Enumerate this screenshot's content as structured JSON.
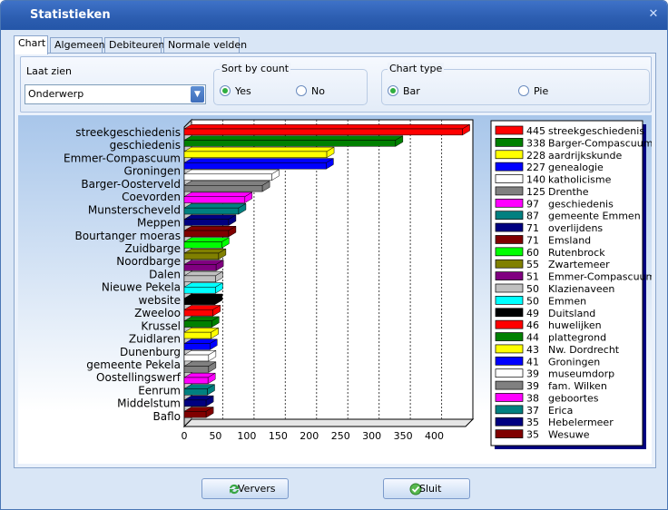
{
  "window": {
    "title": "Statistieken"
  },
  "tabs": [
    {
      "label": "Chart",
      "active": true
    },
    {
      "label": "Algemeen",
      "active": false
    },
    {
      "label": "Debiteuren",
      "active": false
    },
    {
      "label": "Normale velden",
      "active": false
    }
  ],
  "options": {
    "show_label": "Laat zien",
    "show_value": "Onderwerp",
    "sort_label": "Sort by count",
    "sort_yes": "Yes",
    "sort_no": "No",
    "sort_selected": "Yes",
    "type_label": "Chart type",
    "type_bar": "Bar",
    "type_pie": "Pie",
    "type_selected": "Bar"
  },
  "buttons": {
    "refresh": "Ververs",
    "close": "Sluit"
  },
  "chart_data": {
    "type": "bar",
    "orientation": "horizontal",
    "grid": true,
    "legend_position": "right",
    "xlim": [
      0,
      450
    ],
    "xticks": [
      0,
      50,
      100,
      150,
      200,
      250,
      300,
      350,
      400
    ],
    "axis_labels": [
      "streekgeschiedenis",
      "geschiedenis",
      "Emmer-Compascuum",
      "Groningen",
      "Barger-Oosterveld",
      "Coevorden",
      "Munsterscheveld",
      "Meppen",
      "Bourtanger moeras",
      "Zuidbarge",
      "Noordbarge",
      "Dalen",
      "Nieuwe Pekela",
      "website",
      "Zweeloo",
      "Krussel",
      "Zuidlaren",
      "Dunenburg",
      "gemeente Pekela",
      "Oostellingswerf",
      "Eenrum",
      "Middelstum",
      "Baflo"
    ],
    "series": [
      {
        "category": "streekgeschiedenis",
        "value": 445,
        "color": "#ff0000"
      },
      {
        "category": "Barger-Compascuum",
        "value": 338,
        "color": "#008000"
      },
      {
        "category": "aardrijkskunde",
        "value": 228,
        "color": "#ffff00"
      },
      {
        "category": "genealogie",
        "value": 227,
        "color": "#0000ff"
      },
      {
        "category": "katholicisme",
        "value": 140,
        "color": "#ffffff"
      },
      {
        "category": "Drenthe",
        "value": 125,
        "color": "#808080"
      },
      {
        "category": "geschiedenis",
        "value": 97,
        "color": "#ff00ff"
      },
      {
        "category": "gemeente Emmen",
        "value": 87,
        "color": "#008080"
      },
      {
        "category": "overlijdens",
        "value": 71,
        "color": "#000080"
      },
      {
        "category": "Emsland",
        "value": 71,
        "color": "#800000"
      },
      {
        "category": "Rutenbrock",
        "value": 60,
        "color": "#00ff00"
      },
      {
        "category": "Zwartemeer",
        "value": 55,
        "color": "#808000"
      },
      {
        "category": "Emmer-Compascuum",
        "value": 51,
        "color": "#800080"
      },
      {
        "category": "Klazienaveen",
        "value": 50,
        "color": "#c0c0c0"
      },
      {
        "category": "Emmen",
        "value": 50,
        "color": "#00ffff"
      },
      {
        "category": "Duitsland",
        "value": 49,
        "color": "#000000"
      },
      {
        "category": "huwelijken",
        "value": 46,
        "color": "#ff0000"
      },
      {
        "category": "plattegrond",
        "value": 44,
        "color": "#008000"
      },
      {
        "category": "Nw. Dordrecht",
        "value": 43,
        "color": "#ffff00"
      },
      {
        "category": "Groningen",
        "value": 41,
        "color": "#0000ff"
      },
      {
        "category": "museumdorp",
        "value": 39,
        "color": "#ffffff"
      },
      {
        "category": "fam. Wilken",
        "value": 39,
        "color": "#808080"
      },
      {
        "category": "geboortes",
        "value": 38,
        "color": "#ff00ff"
      },
      {
        "category": "Erica",
        "value": 37,
        "color": "#008080"
      },
      {
        "category": "Hebelermeer",
        "value": 35,
        "color": "#000080"
      },
      {
        "category": "Wesuwe",
        "value": 35,
        "color": "#800000"
      }
    ]
  }
}
